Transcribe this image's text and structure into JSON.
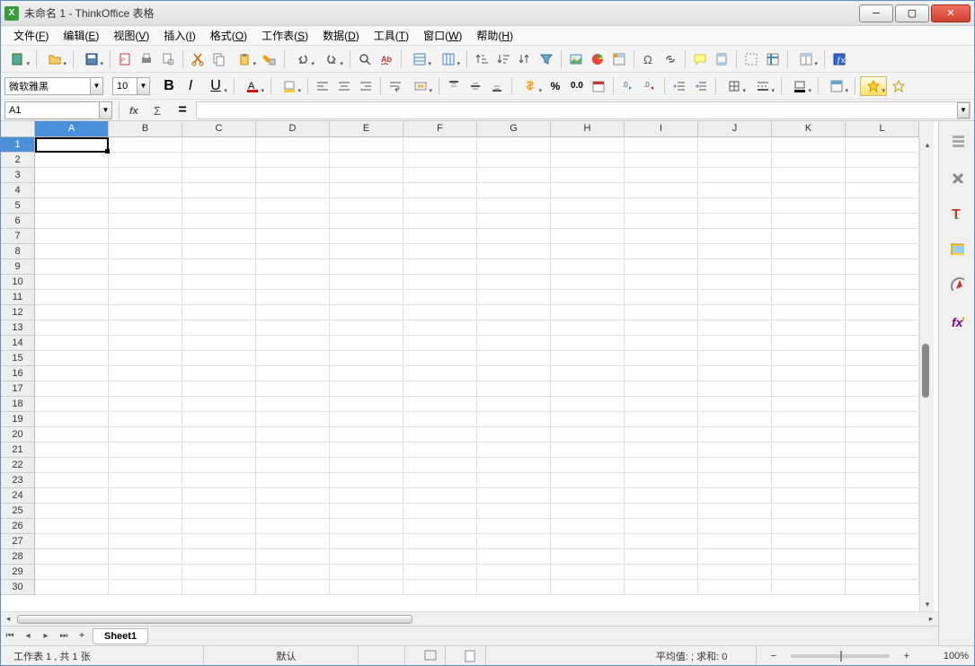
{
  "titlebar": {
    "app_icon_letter": "X",
    "title": "未命名 1 - ThinkOffice 表格"
  },
  "menu": [
    {
      "label": "文件",
      "key": "F"
    },
    {
      "label": "编辑",
      "key": "E"
    },
    {
      "label": "视图",
      "key": "V"
    },
    {
      "label": "插入",
      "key": "I"
    },
    {
      "label": "格式",
      "key": "O"
    },
    {
      "label": "工作表",
      "key": "S"
    },
    {
      "label": "数据",
      "key": "D"
    },
    {
      "label": "工具",
      "key": "T"
    },
    {
      "label": "窗口",
      "key": "W"
    },
    {
      "label": "帮助",
      "key": "H"
    }
  ],
  "toolbar2": {
    "font_name": "微软雅黑",
    "font_size": "10",
    "percent_label": "%",
    "decimal_label": "0.0"
  },
  "formulabar": {
    "cell_ref": "A1",
    "formula": "",
    "equals": "="
  },
  "columns": [
    "A",
    "B",
    "C",
    "D",
    "E",
    "F",
    "G",
    "H",
    "I",
    "J",
    "K",
    "L"
  ],
  "rows": [
    "1",
    "2",
    "3",
    "4",
    "5",
    "6",
    "7",
    "8",
    "9",
    "10",
    "11",
    "12",
    "13",
    "14",
    "15",
    "16",
    "17",
    "18",
    "19",
    "20",
    "21",
    "22",
    "23",
    "24",
    "25",
    "26",
    "27",
    "28",
    "29",
    "30"
  ],
  "selected": {
    "col": 0,
    "row": 0
  },
  "tabs": {
    "sheet1": "Sheet1",
    "add": "+"
  },
  "statusbar": {
    "sheet_info": "工作表 1 , 共 1 张",
    "style": "默认",
    "stats": "平均值: ; 求和: 0",
    "zoom": "100%"
  }
}
